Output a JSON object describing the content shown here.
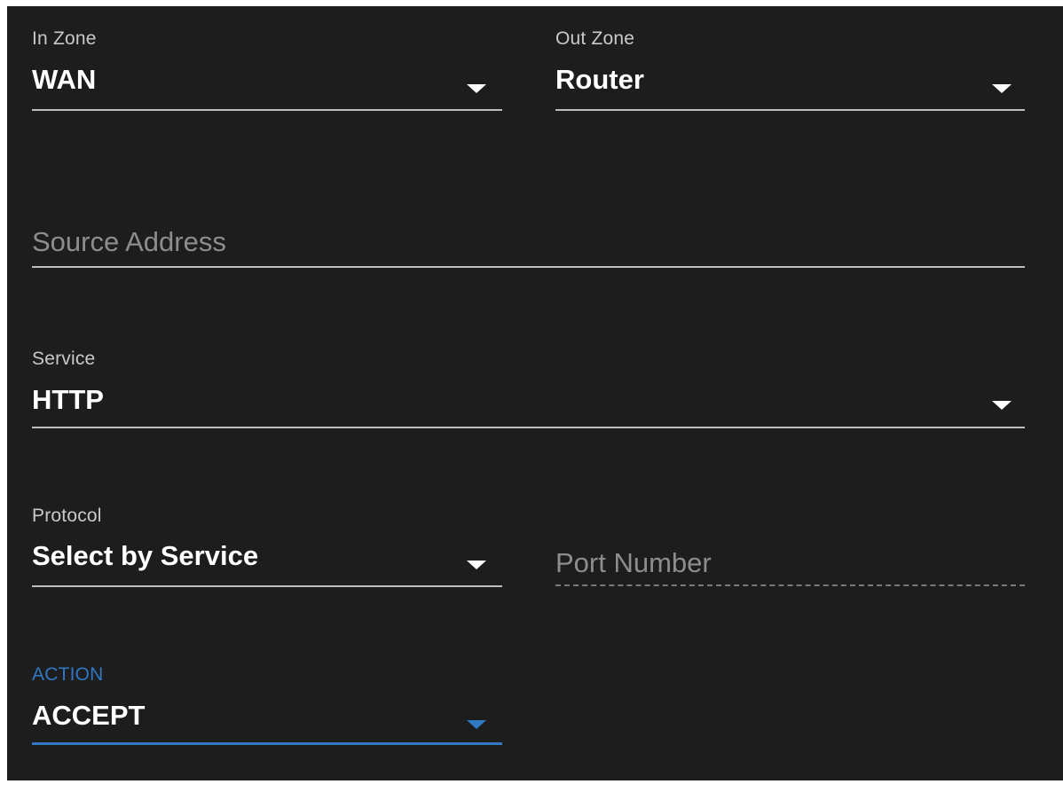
{
  "in_zone": {
    "label": "In Zone",
    "value": "WAN",
    "icon": "chevron-down-icon"
  },
  "out_zone": {
    "label": "Out Zone",
    "value": "Router",
    "icon": "chevron-down-icon"
  },
  "source_address": {
    "placeholder": "Source Address",
    "value": ""
  },
  "service": {
    "label": "Service",
    "value": "HTTP",
    "icon": "chevron-down-icon"
  },
  "protocol": {
    "label": "Protocol",
    "value": "Select by Service",
    "icon": "chevron-down-icon"
  },
  "port_number": {
    "placeholder": "Port Number",
    "value": ""
  },
  "action": {
    "label": "ACTION",
    "value": "ACCEPT",
    "icon": "chevron-down-icon"
  },
  "colors": {
    "background": "#1d1d1d",
    "text": "#ffffff",
    "label": "#c9c9c9",
    "placeholder": "#8d8d8d",
    "accent": "#2f78c4"
  }
}
